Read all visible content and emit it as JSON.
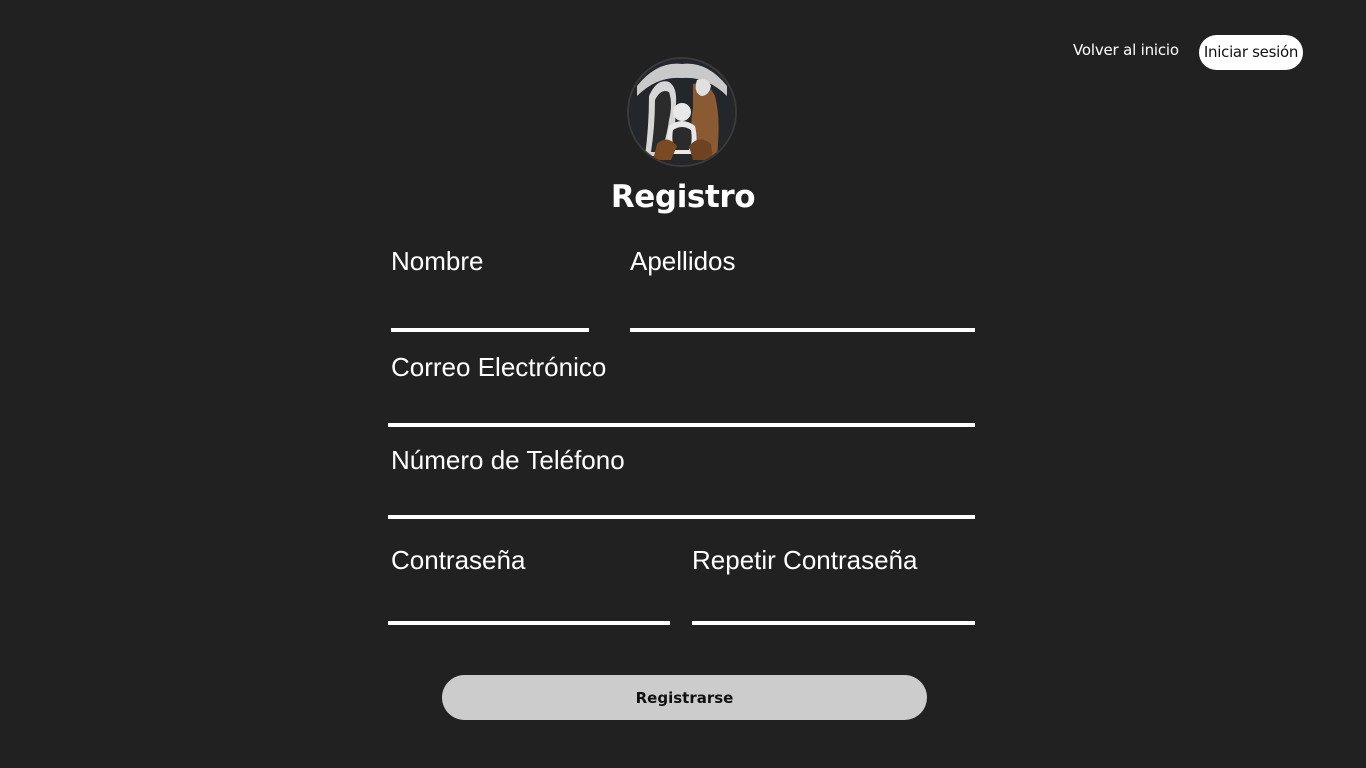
{
  "nav": {
    "home_label": "Volver al inicio",
    "login_label": "Iniciar sesión"
  },
  "logo": {
    "icon": "holy-family-logo"
  },
  "form": {
    "title": "Registro",
    "fields": {
      "nombre": {
        "label": "Nombre",
        "value": ""
      },
      "apellidos": {
        "label": "Apellidos",
        "value": ""
      },
      "correo": {
        "label": "Correo Electrónico",
        "value": ""
      },
      "telefono": {
        "label": "Número de Teléfono",
        "value": ""
      },
      "contrasena": {
        "label": "Contraseña",
        "value": ""
      },
      "repetir": {
        "label": "Repetir Contraseña",
        "value": ""
      }
    },
    "submit_label": "Registrarse"
  },
  "colors": {
    "background": "#212121",
    "text": "#ffffff",
    "button_bg": "#cccccc"
  }
}
